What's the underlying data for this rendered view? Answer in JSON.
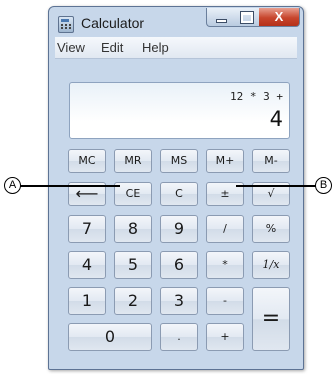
{
  "window": {
    "title": "Calculator",
    "close_glyph": "X"
  },
  "menu": [
    "View",
    "Edit",
    "Help"
  ],
  "display": {
    "expression": "12 * 3 +",
    "value": "4"
  },
  "keys": {
    "mc": "MC",
    "mr": "MR",
    "ms": "MS",
    "mplus": "M+",
    "mminus": "M-",
    "backspace": "⟵",
    "ce": "CE",
    "c": "C",
    "plusminus": "±",
    "sqrt": "√",
    "n7": "7",
    "n8": "8",
    "n9": "9",
    "divide": "/",
    "percent": "%",
    "n4": "4",
    "n5": "5",
    "n6": "6",
    "multiply": "*",
    "reciprocal": "1/x",
    "n1": "1",
    "n2": "2",
    "n3": "3",
    "minus": "-",
    "equals": "=",
    "n0": "0",
    "decimal": ".",
    "plus": "+"
  },
  "callouts": {
    "a": "A",
    "b": "B"
  },
  "colors": {
    "window_frame": "#c7d7ea",
    "close_button": "#c7452c"
  }
}
